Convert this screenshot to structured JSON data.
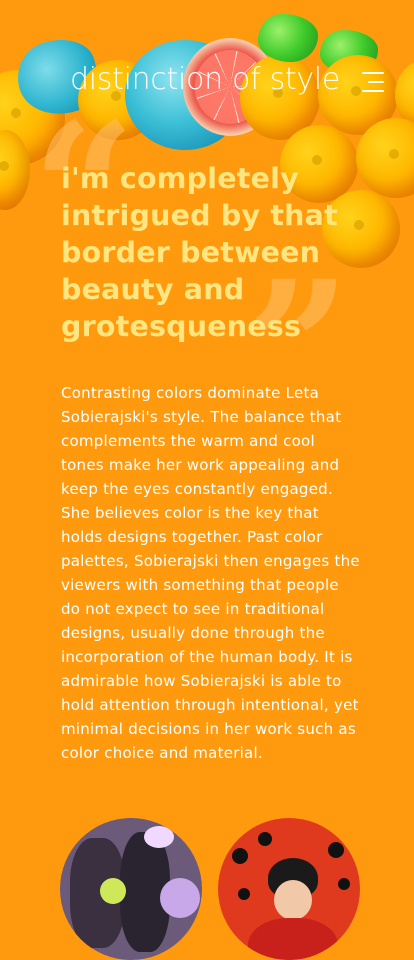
{
  "header": {
    "site_title": "distinction of style",
    "menu_icon": "hamburger-menu-icon"
  },
  "quote": {
    "open_mark": "“",
    "close_mark": "”",
    "text": "i'm completely intrigued by that border between beauty and grotesqueness"
  },
  "article": {
    "body": "Contrasting colors dominate Leta Sobierajski's style. The balance that complements the warm and cool tones make her work appealing and keep the eyes constantly engaged. She believes color is the key that holds designs together. Past color palettes, Sobierajski then engages the viewers with something that people do not expect to see in traditional designs, usually done through the incorporation of the human body. It is admirable how Sobierajski is able to hold attention through intentional, yet minimal decisions in her work such as color choice and material."
  },
  "colors": {
    "background": "#ff9a0e",
    "quote_text": "#ffe680",
    "body_text": "#ffffff"
  }
}
